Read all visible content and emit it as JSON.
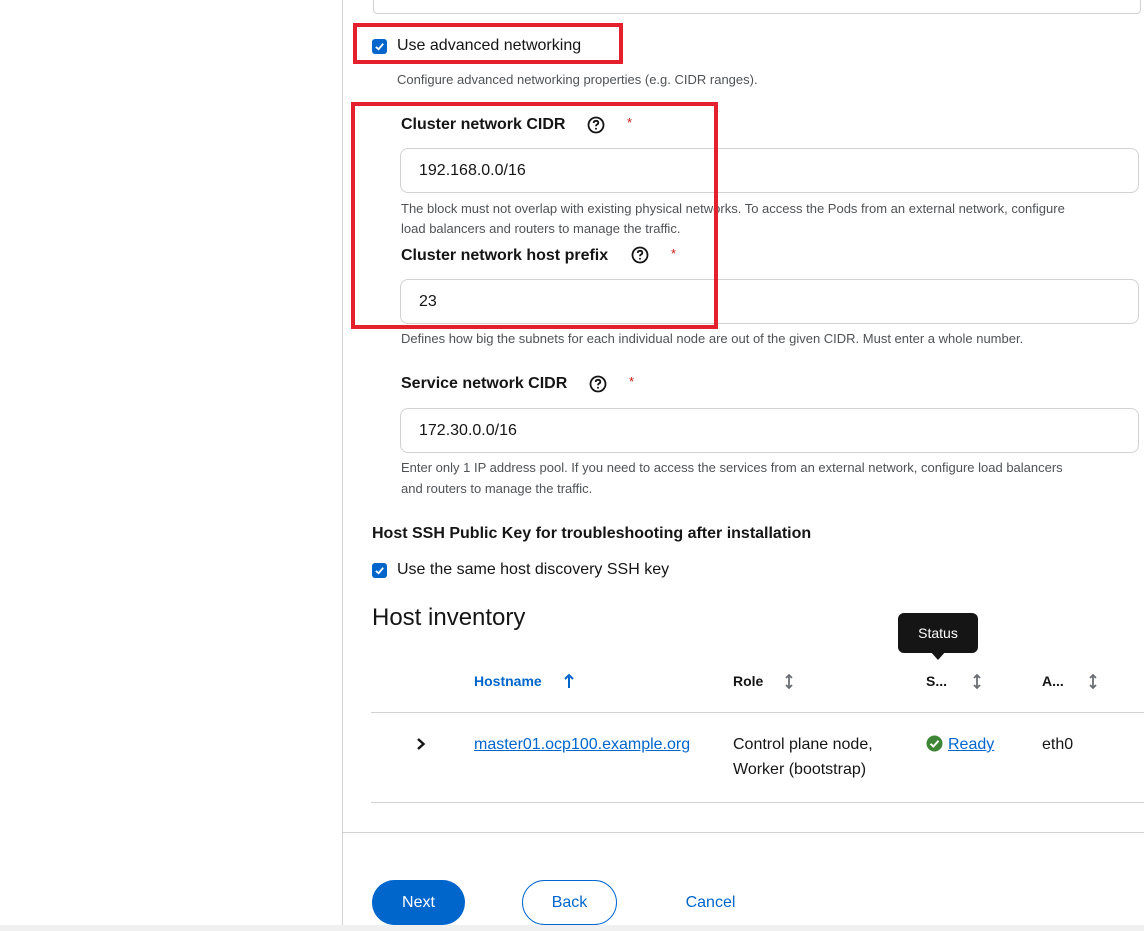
{
  "advanced": {
    "checkbox_label": "Use advanced networking",
    "helper": "Configure advanced networking properties (e.g. CIDR ranges).",
    "checked": true
  },
  "cluster_cidr": {
    "label": "Cluster network CIDR",
    "required_mark": "*",
    "value": "192.168.0.0/16",
    "helper_line1": "The block must not overlap with existing physical networks. To access the Pods from an external network, configure",
    "helper_line2": "load balancers and routers to manage the traffic."
  },
  "host_prefix": {
    "label": "Cluster network host prefix",
    "required_mark": "*",
    "value": "23",
    "helper": "Defines how big the subnets for each individual node are out of the given CIDR. Must enter a whole number."
  },
  "service_cidr": {
    "label": "Service network CIDR",
    "required_mark": "*",
    "value": "172.30.0.0/16",
    "helper_line1": "Enter only 1 IP address pool. If you need to access the services from an external network, configure load balancers",
    "helper_line2": "and routers to manage the traffic."
  },
  "ssh": {
    "section_title": "Host SSH Public Key for troubleshooting after installation",
    "checkbox_label": "Use the same host discovery SSH key",
    "checked": true
  },
  "inventory": {
    "title": "Host inventory",
    "tooltip": "Status",
    "columns": {
      "hostname": "Hostname",
      "role": "Role",
      "status": "S...",
      "address": "A..."
    },
    "rows": [
      {
        "hostname": "master01.ocp100.example.org",
        "role_line1": "Control plane node,",
        "role_line2": "Worker (bootstrap)",
        "status": "Ready",
        "nic": "eth0"
      }
    ]
  },
  "footer": {
    "next": "Next",
    "back": "Back",
    "cancel": "Cancel"
  },
  "colors": {
    "primary": "#0066cc",
    "highlight_box": "#e4202d",
    "ready": "#3e8635",
    "required": "#c9190b"
  },
  "icons": {
    "help": "question-circle-icon",
    "sort": "sort-arrows-icon",
    "sort_active": "arrow-up-icon",
    "expand": "chevron-right-icon",
    "status_ok": "check-circle-icon"
  }
}
